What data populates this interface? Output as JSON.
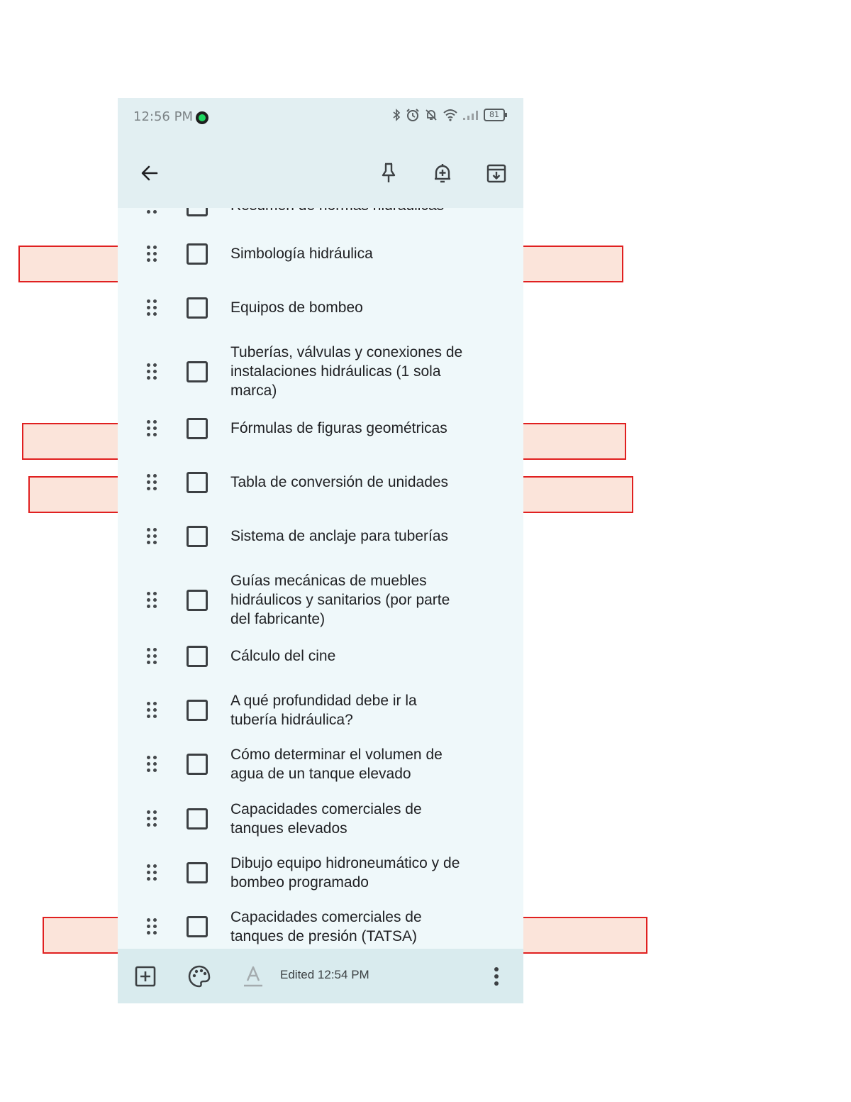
{
  "status_bar": {
    "time": "12:56 PM",
    "battery": "81",
    "icons": [
      "spotify-icon",
      "bluetooth-icon",
      "alarm-icon",
      "bell-off-icon",
      "wifi-icon",
      "signal-icon",
      "battery-icon"
    ]
  },
  "toolbar": {
    "back_icon": "arrow-left-icon",
    "pin_icon": "pin-icon",
    "reminder_icon": "bell-plus-icon",
    "archive_icon": "archive-icon"
  },
  "checklist": {
    "items": [
      {
        "text": "Resumen de normas hidráulicas",
        "checked": false
      },
      {
        "text": "Simbología hidráulica",
        "checked": false
      },
      {
        "text": "Equipos de bombeo",
        "checked": false
      },
      {
        "text": "Tuberías, válvulas y conexiones de instalaciones hidráulicas (1 sola marca)",
        "checked": false
      },
      {
        "text": "Fórmulas de figuras geométricas",
        "checked": false
      },
      {
        "text": "Tabla de conversión de unidades",
        "checked": false
      },
      {
        "text": "Sistema de anclaje para tuberías",
        "checked": false
      },
      {
        "text": "Guías mecánicas de muebles hidráulicos y sanitarios (por parte del fabricante)",
        "checked": false
      },
      {
        "text": "Cálculo del cine",
        "checked": false
      },
      {
        "text": "A qué profundidad debe ir la tubería hidráulica?",
        "checked": false
      },
      {
        "text": "Cómo determinar el volumen de agua de un tanque elevado",
        "checked": false
      },
      {
        "text": "Capacidades comerciales de tanques elevados",
        "checked": false
      },
      {
        "text": "Dibujo equipo hidroneumático y de bombeo programado",
        "checked": false
      },
      {
        "text": "Capacidades comerciales de tanques de presión (TATSA)",
        "checked": false
      }
    ]
  },
  "bottom_bar": {
    "add_icon": "add-box-icon",
    "palette_icon": "palette-icon",
    "text_format_icon": "text-format-icon",
    "edited": "Edited 12:54 PM",
    "more_icon": "more-vert-icon"
  },
  "colors": {
    "highlight_fill": "#fbe4da",
    "highlight_border": "#e02020",
    "note_background": "#eff8fa",
    "bar_background": "#e2eff2"
  }
}
